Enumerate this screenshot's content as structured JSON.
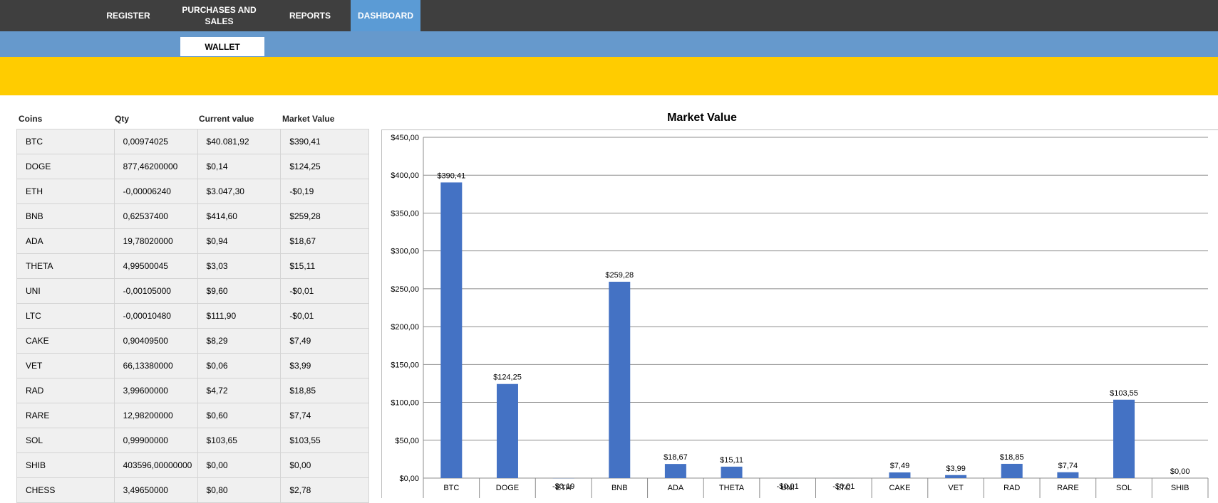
{
  "nav": {
    "items": [
      {
        "label": "REGISTER"
      },
      {
        "label": "PURCHASES AND"
      },
      {
        "label": "SALES"
      },
      {
        "label": "REPORTS"
      },
      {
        "label": "DASHBOARD"
      }
    ],
    "active": "DASHBOARD"
  },
  "subnav": {
    "wallet": "WALLET"
  },
  "colors": {
    "topbar": "#3f3f3f",
    "active_tab": "#5b9bd5",
    "subbar": "#6699cc",
    "banner": "#ffcc00",
    "bar": "#4472c4"
  },
  "table": {
    "headers": [
      "Coins",
      "Qty",
      "Current value",
      "Market Value"
    ],
    "rows": [
      [
        "BTC",
        "0,00974025",
        "$40.081,92",
        "$390,41"
      ],
      [
        "DOGE",
        "877,46200000",
        "$0,14",
        "$124,25"
      ],
      [
        "ETH",
        "-0,00006240",
        "$3.047,30",
        "-$0,19"
      ],
      [
        "BNB",
        "0,62537400",
        "$414,60",
        "$259,28"
      ],
      [
        "ADA",
        "19,78020000",
        "$0,94",
        "$18,67"
      ],
      [
        "THETA",
        "4,99500045",
        "$3,03",
        "$15,11"
      ],
      [
        "UNI",
        "-0,00105000",
        "$9,60",
        "-$0,01"
      ],
      [
        "LTC",
        "-0,00010480",
        "$111,90",
        "-$0,01"
      ],
      [
        "CAKE",
        "0,90409500",
        "$8,29",
        "$7,49"
      ],
      [
        "VET",
        "66,13380000",
        "$0,06",
        "$3,99"
      ],
      [
        "RAD",
        "3,99600000",
        "$4,72",
        "$18,85"
      ],
      [
        "RARE",
        "12,98200000",
        "$0,60",
        "$7,74"
      ],
      [
        "SOL",
        "0,99900000",
        "$103,65",
        "$103,55"
      ],
      [
        "SHIB",
        "403596,00000000",
        "$0,00",
        "$0,00"
      ],
      [
        "CHESS",
        "3,49650000",
        "$0,80",
        "$2,78"
      ]
    ]
  },
  "chart_data": {
    "type": "bar",
    "title": "Market Value",
    "categories": [
      "BTC",
      "DOGE",
      "ETH",
      "BNB",
      "ADA",
      "THETA",
      "UNI",
      "LTC",
      "CAKE",
      "VET",
      "RAD",
      "RARE",
      "SOL",
      "SHIB"
    ],
    "values": [
      390.41,
      124.25,
      -0.19,
      259.28,
      18.67,
      15.11,
      -0.01,
      -0.01,
      7.49,
      3.99,
      18.85,
      7.74,
      103.55,
      0.0
    ],
    "data_labels": [
      "$390,41",
      "$124,25",
      "-$0,19",
      "$259,28",
      "$18,67",
      "$15,11",
      "-$0,01",
      "-$0,01",
      "$7,49",
      "$3,99",
      "$18,85",
      "$7,74",
      "$103,55",
      "$0,00"
    ],
    "y_ticks": [
      "$0,00",
      "$50,00",
      "$100,00",
      "$150,00",
      "$200,00",
      "$250,00",
      "$300,00",
      "$350,00",
      "$400,00",
      "$450,00"
    ],
    "ylim": [
      0,
      450
    ],
    "grid": true,
    "xlabel": "",
    "ylabel": ""
  }
}
